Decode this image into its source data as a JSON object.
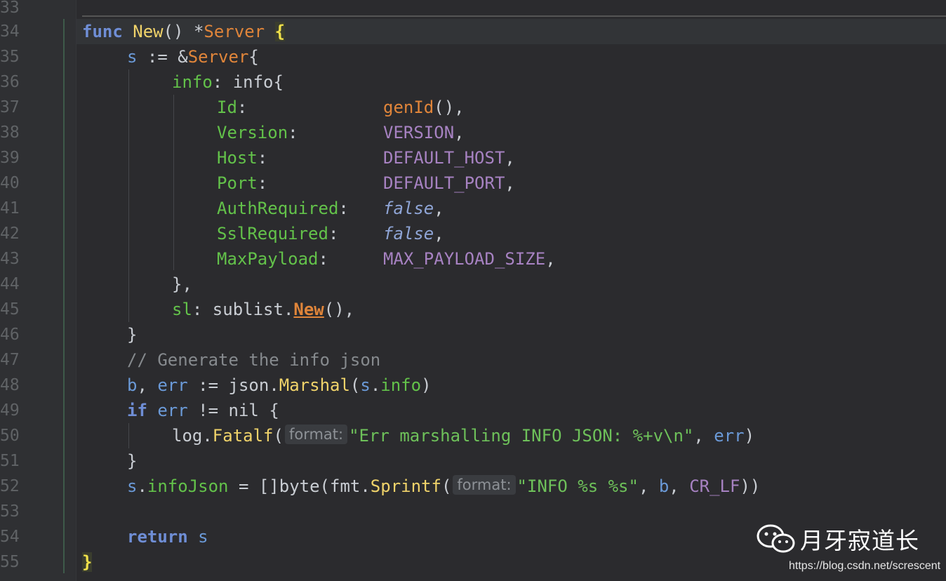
{
  "editor": {
    "line_numbers": [
      "33",
      "34",
      "35",
      "36",
      "37",
      "38",
      "39",
      "40",
      "41",
      "42",
      "43",
      "44",
      "45",
      "46",
      "47",
      "48",
      "49",
      "50",
      "51",
      "52",
      "53",
      "54",
      "55"
    ],
    "lines": {
      "l34": {
        "func": "func",
        "name": "New",
        "rest": "() *",
        "type": "Server",
        "brace": "{"
      },
      "l35": {
        "var": "s",
        "op": " := &",
        "type": "Server",
        "brace": "{"
      },
      "l36": {
        "field": "info",
        "rest": ": info{"
      },
      "l37": {
        "field": "Id",
        "colon": ":",
        "call": "genId",
        "tail": "(),"
      },
      "l38": {
        "field": "Version",
        "colon": ":",
        "const": "VERSION",
        "tail": ","
      },
      "l39": {
        "field": "Host",
        "colon": ":",
        "const": "DEFAULT_HOST",
        "tail": ","
      },
      "l40": {
        "field": "Port",
        "colon": ":",
        "const": "DEFAULT_PORT",
        "tail": ","
      },
      "l41": {
        "field": "AuthRequired",
        "colon": ":",
        "value": "false",
        "tail": ","
      },
      "l42": {
        "field": "SslRequired",
        "colon": ":",
        "value": "false",
        "tail": ","
      },
      "l43": {
        "field": "MaxPayload",
        "colon": ":",
        "const": "MAX_PAYLOAD_SIZE",
        "tail": ","
      },
      "l44": {
        "text": "},"
      },
      "l45": {
        "field": "sl",
        "mid": ": sublist.",
        "call": "New",
        "tail": "(),"
      },
      "l46": {
        "text": "}"
      },
      "l47": {
        "comment": "// Generate the info json"
      },
      "l48": {
        "v1": "b",
        "sep": ", ",
        "v2": "err",
        "op": " := json.",
        "call": "Marshal",
        "open": "(",
        "v3": "s",
        "dot": ".",
        "field": "info",
        "close": ")"
      },
      "l49": {
        "kw": "if",
        "v": "err",
        "rest": " != nil {"
      },
      "l50": {
        "pre": "log.",
        "call": "Fatalf",
        "open": "(",
        "hint": "format:",
        "str": "\"Err marshalling INFO JSON: %+v\\n\"",
        "sep": ", ",
        "v": "err",
        "close": ")"
      },
      "l51": {
        "text": "}"
      },
      "l52": {
        "v": "s",
        "dot": ".",
        "field": "infoJson",
        "mid": " = []byte(fmt.",
        "call": "Sprintf",
        "open": "(",
        "hint": "format:",
        "str": "\"INFO %s %s\"",
        "sep1": ", ",
        "b": "b",
        "sep2": ", ",
        "const": "CR_LF",
        "close": "))"
      },
      "l54": {
        "kw": "return",
        "v": "s"
      },
      "l55": {
        "brace": "}"
      }
    }
  },
  "watermark": {
    "name": "月牙寂道长",
    "url": "https://blog.csdn.net/screscent"
  }
}
